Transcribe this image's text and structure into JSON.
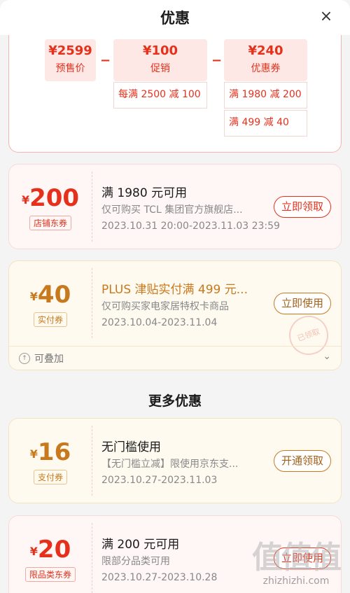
{
  "header": {
    "title": "优惠",
    "close_icon": "×"
  },
  "calc": {
    "presale": {
      "value": "¥2599",
      "label": "预售价"
    },
    "minus1": "−",
    "promo": {
      "value": "¥100",
      "label": "促销"
    },
    "minus2": "−",
    "coupon": {
      "value": "¥240",
      "label": "优惠券"
    },
    "promo_rules": [
      "每满 2500 减 100"
    ],
    "coupon_rules": [
      "满 1980 减 200",
      "满 499 减 40"
    ]
  },
  "coupons": [
    {
      "yen": "¥",
      "amount": "200",
      "tag": "店铺东券",
      "title": "满 1980 元可用",
      "desc": "仅可购买 TCL 集团官方旗舰店...",
      "date": "2023.10.31 20:00-2023.11.03 23:59",
      "button": "立即领取"
    },
    {
      "yen": "¥",
      "amount": "40",
      "tag": "实付券",
      "title": "PLUS 津贴实付满 499 元...",
      "desc": "仅可购买家电家居特权卡商品",
      "date": "2023.10.04-2023.11.04",
      "button": "立即使用",
      "stack_label": "可叠加",
      "stamp": "已领取"
    }
  ],
  "more": {
    "section_title": "更多优惠",
    "coupons": [
      {
        "yen": "¥",
        "amount": "16",
        "tag": "支付券",
        "title": "无门槛使用",
        "desc": "【无门槛立减】限使用京东支...",
        "date": "2023.10.27-2023.11.03",
        "button": "开通领取"
      },
      {
        "yen": "¥",
        "amount": "20",
        "tag": "限品类东券",
        "title": "满 200 元可用",
        "desc": "限部分品类可用",
        "date": "2023.10.27-2023.10.28",
        "button": "立即使用"
      }
    ]
  },
  "watermark": {
    "logo": "值值值",
    "url": "zhizhizhi.com"
  },
  "icons": {
    "close": "close-icon",
    "stack": "stack-icon",
    "chevron": "chevron-down-icon"
  },
  "colors": {
    "accent_red": "#e5311c",
    "accent_gold": "#c8791d"
  }
}
